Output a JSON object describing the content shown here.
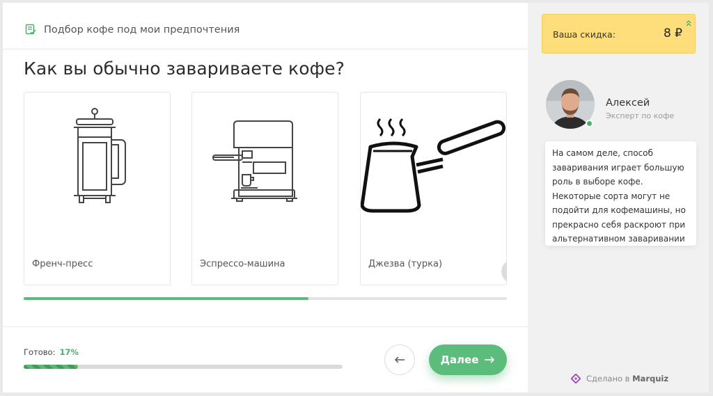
{
  "header": {
    "title": "Подбор кофе под мои предпочтения",
    "icon": "checklist-icon"
  },
  "question": "Как вы обычно завариваете кофе?",
  "options": [
    {
      "label": "Френч-пресс",
      "icon": "french-press-icon"
    },
    {
      "label": "Эспрессо-машина",
      "icon": "espresso-machine-icon"
    },
    {
      "label": "Джезва (турка)",
      "icon": "cezve-icon"
    }
  ],
  "carousel": {
    "scroll_position": 0.59
  },
  "footer": {
    "ready_label": "Готово:",
    "ready_percent": "17%",
    "progress": 0.17,
    "next_label": "Далее"
  },
  "sidebar": {
    "discount_label": "Ваша скидка:",
    "discount_value": "8 ₽",
    "expert_name": "Алексей",
    "expert_role": "Эксперт по кофе",
    "expert_message": "На самом деле, способ\nзаваривания играет большую\nроль в выборе кофе.\nНекоторые сорта могут не\nподойти для кофемашины, но\nпрекрасно себя раскроют при\nальтернативном заваривании",
    "made_prefix": "Сделано в",
    "made_brand": "Marquiz"
  },
  "colors": {
    "accent": "#5cbc7c",
    "discount_bg": "#fdde7b",
    "online": "#3fba5f",
    "brand": "#a24fc4"
  }
}
